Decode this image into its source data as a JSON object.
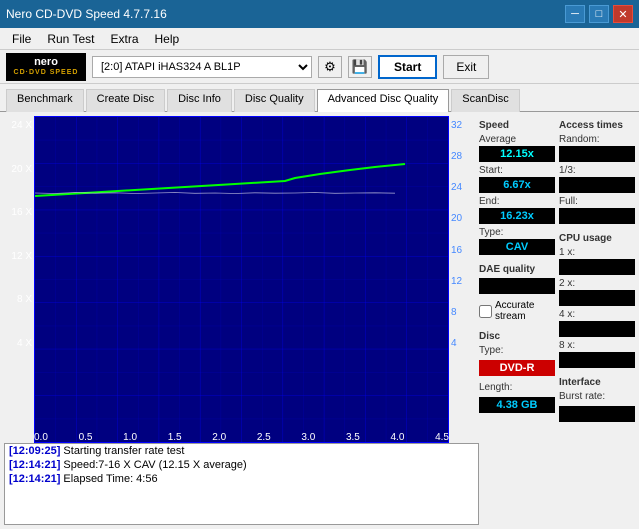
{
  "window": {
    "title": "Nero CD-DVD Speed 4.7.7.16",
    "controls": [
      "─",
      "□",
      "✕"
    ]
  },
  "menu": {
    "items": [
      "File",
      "Run Test",
      "Extra",
      "Help"
    ]
  },
  "toolbar": {
    "logo_line1": "nero",
    "logo_line2": "CD·DVD SPEED",
    "drive": "[2:0]  ATAPI iHAS324  A BL1P",
    "start_label": "Start",
    "exit_label": "Exit"
  },
  "tabs": [
    {
      "label": "Benchmark",
      "active": false
    },
    {
      "label": "Create Disc",
      "active": false
    },
    {
      "label": "Disc Info",
      "active": false
    },
    {
      "label": "Disc Quality",
      "active": false
    },
    {
      "label": "Advanced Disc Quality",
      "active": true
    },
    {
      "label": "ScanDisc",
      "active": false
    }
  ],
  "speed_panel": {
    "title": "Speed",
    "average_label": "Average",
    "average_value": "12.15x",
    "start_label": "Start:",
    "start_value": "6.67x",
    "end_label": "End:",
    "end_value": "16.23x",
    "type_label": "Type:",
    "type_value": "CAV"
  },
  "access_times_panel": {
    "title": "Access times",
    "random_label": "Random:",
    "random_value": "",
    "third_label": "1/3:",
    "third_value": "",
    "full_label": "Full:",
    "full_value": ""
  },
  "dae_panel": {
    "title": "DAE quality",
    "value": "",
    "accurate_stream_label": "Accurate stream",
    "checked": false
  },
  "cpu_panel": {
    "title": "CPU usage",
    "1x_label": "1 x:",
    "1x_value": "",
    "2x_label": "2 x:",
    "2x_value": "",
    "4x_label": "4 x:",
    "4x_value": "",
    "8x_label": "8 x:",
    "8x_value": ""
  },
  "disc_panel": {
    "title": "Disc",
    "type_label": "Type:",
    "type_value": "DVD-R",
    "length_label": "Length:",
    "length_value": "4.38 GB"
  },
  "interface_panel": {
    "title": "Interface",
    "burst_label": "Burst rate:",
    "burst_value": ""
  },
  "chart": {
    "y_axis_left": [
      "24 X",
      "20 X",
      "16 X",
      "12 X",
      "8 X",
      "4 X"
    ],
    "y_axis_right": [
      "32",
      "28",
      "24",
      "20",
      "16",
      "12",
      "8",
      "4"
    ],
    "x_axis": [
      "0.0",
      "0.5",
      "1.0",
      "1.5",
      "2.0",
      "2.5",
      "3.0",
      "3.5",
      "4.0",
      "4.5"
    ]
  },
  "log": {
    "entries": [
      {
        "time": "[12:09:25]",
        "message": "Starting transfer rate test"
      },
      {
        "time": "[12:14:21]",
        "message": "Speed:7-16 X CAV (12.15 X average)"
      },
      {
        "time": "[12:14:21]",
        "message": "Elapsed Time: 4:56"
      }
    ]
  }
}
